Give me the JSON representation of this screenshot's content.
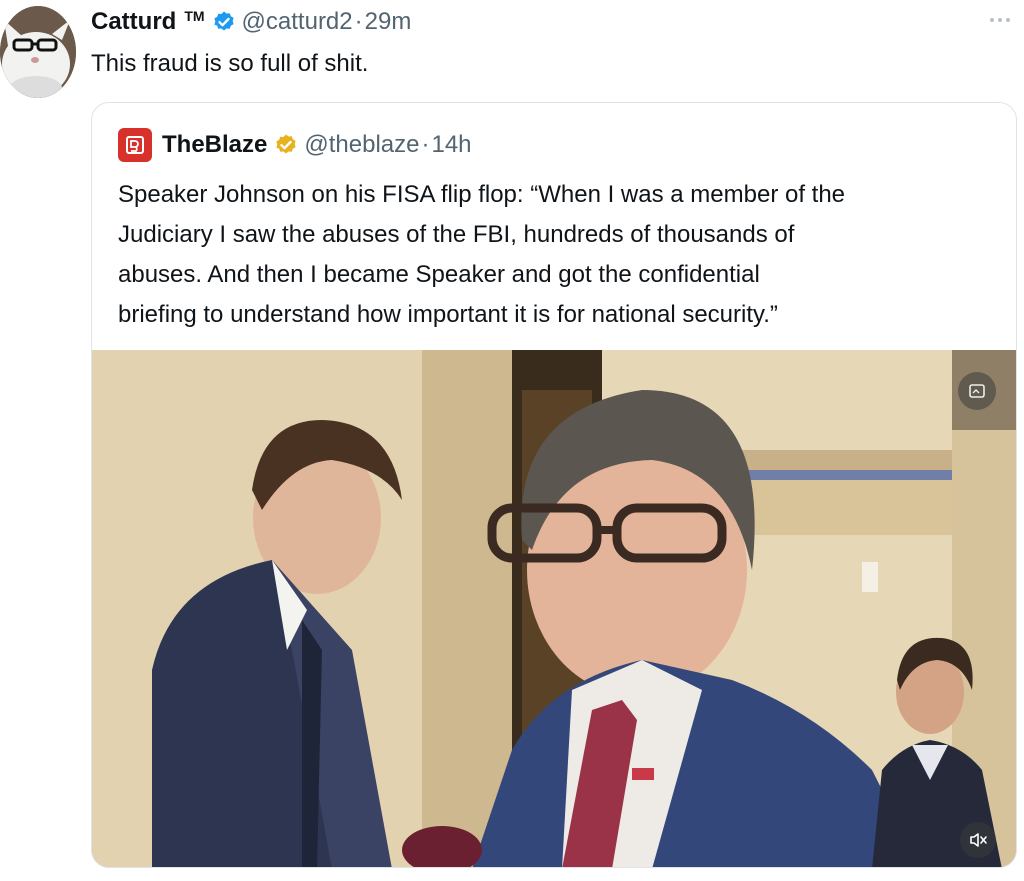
{
  "tweet": {
    "author_name": "Catturd",
    "author_badge": "TM",
    "handle": "@catturd2",
    "separator": "·",
    "time": "29m",
    "text": "This fraud is so full of shit.",
    "verified_color": "#1d9bf0"
  },
  "quote": {
    "author_name": "TheBlaze",
    "handle": "@theblaze",
    "separator": "·",
    "time": "14h",
    "verified_color": "#e8b21f",
    "logo_color": "#d8302b",
    "text_lines": [
      "Speaker Johnson on his FISA flip flop: “When I was a member of the",
      "Judiciary I saw the abuses of the FBI, hundreds of thousands of",
      "abuses. And then I became Speaker and got the confidential",
      "briefing to understand how important it is for national security.”"
    ]
  },
  "icons": {
    "more": "more-horizontal-icon",
    "verified": "verified-badge-icon",
    "mute": "volume-muted-icon",
    "gif": "media-overlay-icon"
  }
}
